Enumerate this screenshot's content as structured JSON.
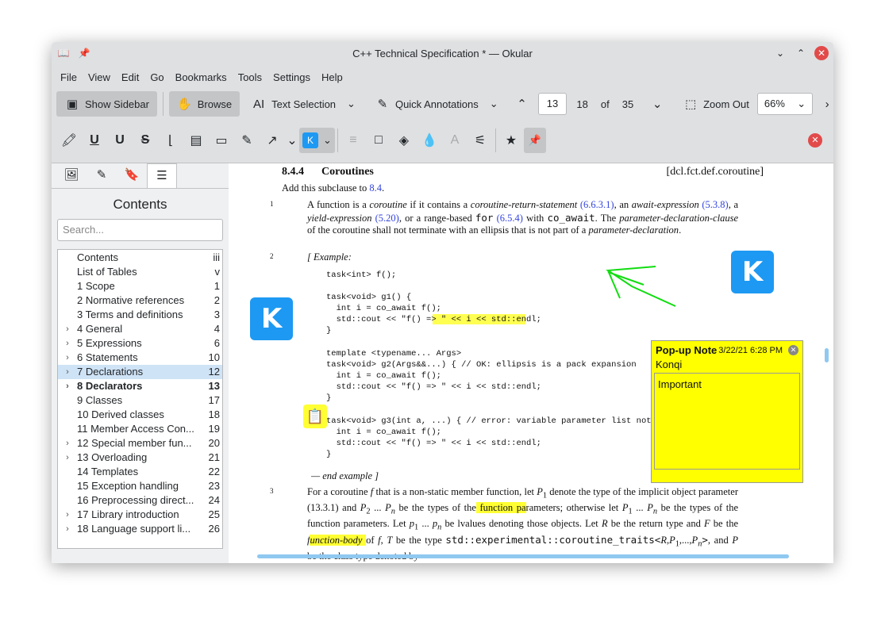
{
  "window": {
    "title": "C++ Technical Specification * — Okular"
  },
  "menu": [
    "File",
    "View",
    "Edit",
    "Go",
    "Bookmarks",
    "Tools",
    "Settings",
    "Help"
  ],
  "toolbar": {
    "show_sidebar": "Show Sidebar",
    "browse": "Browse",
    "text_selection": "Text Selection",
    "quick_annotations": "Quick Annotations",
    "page": "13",
    "page_label": "18",
    "of": "of",
    "total": "35",
    "zoom_out": "Zoom Out",
    "zoom": "66%"
  },
  "sidebar": {
    "title": "Contents",
    "search_placeholder": "Search...",
    "items": [
      {
        "label": "Contents",
        "page": "iii",
        "exp": false
      },
      {
        "label": "List of Tables",
        "page": "v",
        "exp": false
      },
      {
        "label": "1 Scope",
        "page": "1",
        "exp": false
      },
      {
        "label": "2 Normative references",
        "page": "2",
        "exp": false
      },
      {
        "label": "3 Terms and definitions",
        "page": "3",
        "exp": false
      },
      {
        "label": "4 General",
        "page": "4",
        "exp": true
      },
      {
        "label": "5 Expressions",
        "page": "6",
        "exp": true
      },
      {
        "label": "6 Statements",
        "page": "10",
        "exp": true
      },
      {
        "label": "7 Declarations",
        "page": "12",
        "exp": true,
        "sel": true
      },
      {
        "label": "8 Declarators",
        "page": "13",
        "exp": true,
        "bold": true
      },
      {
        "label": "9 Classes",
        "page": "17",
        "exp": false
      },
      {
        "label": "10 Derived classes",
        "page": "18",
        "exp": false
      },
      {
        "label": "11 Member Access Con...",
        "page": "19",
        "exp": false
      },
      {
        "label": "12 Special member fun...",
        "page": "20",
        "exp": true
      },
      {
        "label": "13 Overloading",
        "page": "21",
        "exp": true
      },
      {
        "label": "14 Templates",
        "page": "22",
        "exp": false
      },
      {
        "label": "15 Exception handling",
        "page": "23",
        "exp": false
      },
      {
        "label": "16 Preprocessing direct...",
        "page": "24",
        "exp": false
      },
      {
        "label": "17 Library introduction",
        "page": "25",
        "exp": true
      },
      {
        "label": "18 Language support li...",
        "page": "26",
        "exp": true
      }
    ]
  },
  "doc": {
    "num": "8.4.4",
    "heading": "Coroutines",
    "ref": "[dcl.fct.def.coroutine]",
    "intro": "Add this subclause to ",
    "intro_link": "8.4",
    "intro_end": ".",
    "p1_num": "1",
    "p1": "A function is a <i>coroutine</i> if it contains a <i>coroutine-return-statement</i> <span class=lnk>(6.6.3.1)</span>, an <i>await-expression</i> <span class=lnk>(5.3.8)</span>, a <i>yield-expression</i> <span class=lnk>(5.20)</span>, or a range-based <tt>for</tt> <span class=lnk>(6.5.4)</span> with <tt>co_await</tt>. The <i>parameter-declaration-clause</i> of the coroutine shall not terminate with an ellipsis that is not part of a <i>parameter-declaration</i>.",
    "p2_num": "2",
    "example": "[ Example:",
    "code1": "task<int> f();\n\ntask<void> g1() {\n  int i = co_await f();\n  std::cout << \"f() => \" << i << std::endl;\n}",
    "code2": "template <typename... Args>\ntask<void> g2(Args&&...) { // OK: ellipsis is a pack expansion\n  int i = co_await f();\n  std::cout << \"f() => \" << i << std::endl;\n}",
    "code3": "task<void> g3(int a, ...) { // error: variable parameter list not allowed\n  int i = co_await f();\n  std::cout << \"f() => \" << i << std::endl;\n}",
    "end_example": "— end example ]",
    "p3_num": "3",
    "p3": "For a coroutine <i>f</i> that is a non-static member function, let <i>P</i><sub>1</sub> denote the type of the implicit object parameter (13.3.1) and <i>P</i><sub>2</sub> ... <i>P<sub>n</sub></i> be the types of the<span class=hl> function pa</span>rameters; otherwise let <i>P</i><sub>1</sub> ... <i>P<sub>n</sub></i> be the types of the function parameters. Let <i>p</i><sub>1</sub> ... <i>p<sub>n</sub></i> be lvalues denoting those objects. Let <i>R</i> be the return type and <i>F</i> be the <i>f<span class=hl>unction-body </span></i> of <i>f</i>, <i>T</i> be the type <tt>std::experimental::coroutine_traits&lt;</tt><i>R</i>,<i>P</i><sub>1</sub>,...,<i>P<sub>n</sub></i><tt>&gt;</tt>, and <i>P</i> be the class type denoted by"
  },
  "note": {
    "title": "Pop-up Note",
    "date": "3/22/21 6:28 PM",
    "author": "Konqi",
    "text": "Important"
  },
  "colors": {
    "highlight": "#ffff00",
    "kde": "#1d99f3",
    "selection": "#cfe3f6",
    "close": "#e24a4a"
  }
}
